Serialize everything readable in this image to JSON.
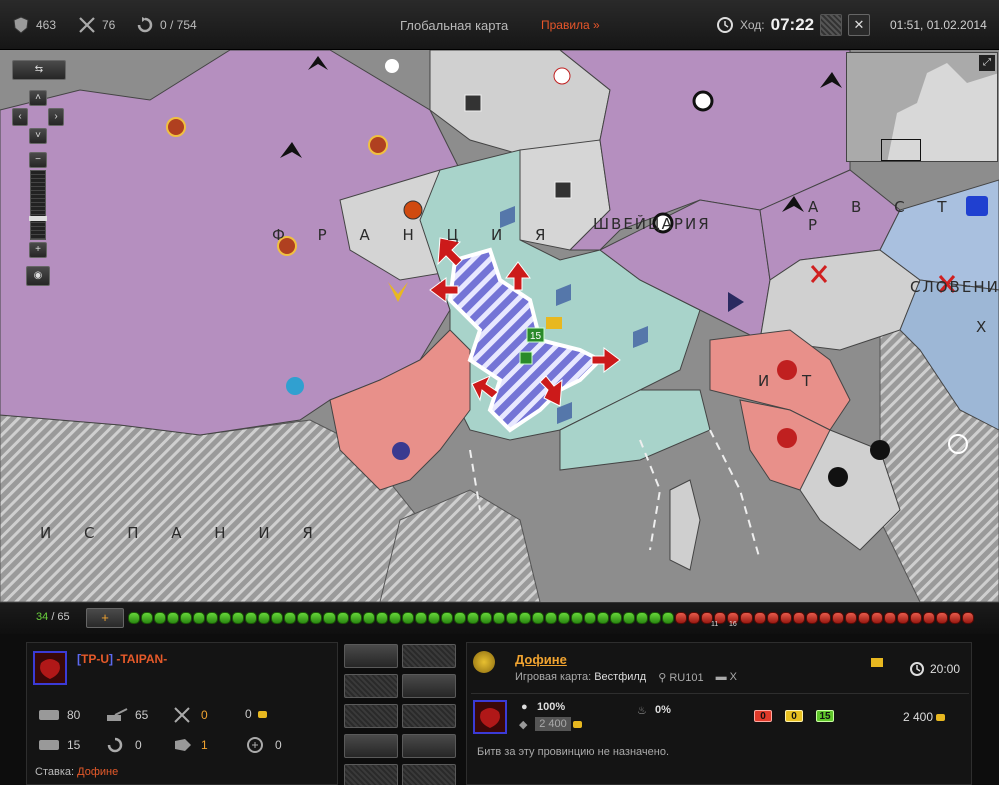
{
  "topbar": {
    "tanks": "463",
    "battles": "76",
    "progress": "0 / 754",
    "title": "Глобальная карта",
    "rules": "Правила »",
    "turn_label": "Ход:",
    "turn_time": "07:22",
    "close": "✕",
    "datetime": "01:51, 01.02.2014"
  },
  "map": {
    "labels": {
      "france": "Ф  Р  А  Н  Ц  И  Я",
      "spain": "И  С  П  А  Н  И  Я",
      "switzerland": "ШВЕЙЦАРИЯ",
      "austria": "А  В  С  Т  Р",
      "italy": "И  Т",
      "slovenia": "СЛОВЕНИ",
      "croatia": "Х"
    },
    "selected_badge": "15",
    "colors": {
      "purple": "#b58fbf",
      "teal": "#a8d3ca",
      "pink": "#e8908a",
      "gray": "#cfcfcf",
      "blue": "#9db7d6",
      "selected": "#6f6fd0"
    }
  },
  "progress": {
    "current": "34",
    "total": "/ 65",
    "add": "+",
    "green_count": 42,
    "red_count": 23,
    "mark_a": "11",
    "mark_b": "16"
  },
  "clan": {
    "tag": "TP-U",
    "name": "-TAIPAN-",
    "stats": {
      "tanks": "80",
      "artillery": "65",
      "battles": "0",
      "gold": "0",
      "tanks2": "15",
      "moves": "0",
      "pieces": "1",
      "medals": "0"
    },
    "bid_label": "Ставка:",
    "bid_value": "Дофине"
  },
  "province": {
    "name": "Дофине",
    "map_label": "Игровая карта:",
    "map_name": "Вестфилд",
    "server": "RU101",
    "tier": "X",
    "prime_time": "20:00",
    "control": "100%",
    "income": "2 400",
    "fire": "0%",
    "red": "0",
    "yellow": "0",
    "green": "15",
    "total": "2 400",
    "note": "Битв за эту провинцию не назначено."
  }
}
